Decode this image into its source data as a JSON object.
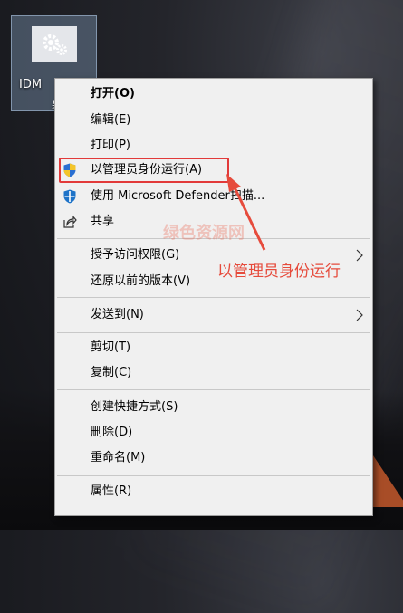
{
  "desktop": {
    "icon_label": "IDM",
    "icon_label_suffix": "桌"
  },
  "context_menu": {
    "items": [
      {
        "label": "打开(O)",
        "icon": null,
        "bold": true
      },
      {
        "label": "编辑(E)"
      },
      {
        "label": "打印(P)"
      },
      {
        "label": "以管理员身份运行(A)",
        "icon": "uac-shield-icon"
      },
      {
        "label": "使用 Microsoft Defender扫描...",
        "icon": "defender-shield-icon"
      },
      {
        "label": "共享",
        "icon": "share-icon"
      },
      {
        "label": "授予访问权限(G)",
        "submenu": true
      },
      {
        "label": "还原以前的版本(V)"
      },
      {
        "label": "发送到(N)",
        "submenu": true
      },
      {
        "label": "剪切(T)"
      },
      {
        "label": "复制(C)"
      },
      {
        "label": "创建快捷方式(S)"
      },
      {
        "label": "删除(D)"
      },
      {
        "label": "重命名(M)"
      },
      {
        "label": "属性(R)"
      }
    ]
  },
  "annotation": {
    "text": "以管理员身份运行",
    "color": "#e64b3c",
    "watermark": "绿色资源网"
  }
}
